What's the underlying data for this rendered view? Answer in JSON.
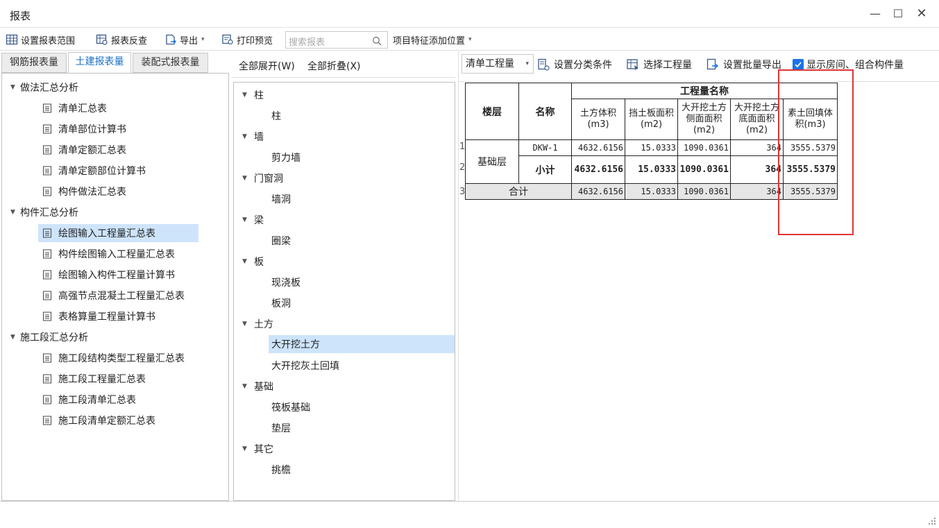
{
  "window": {
    "title": "报表"
  },
  "toolbar": {
    "set_range": "设置报表范围",
    "report_check": "报表反查",
    "export": "导出",
    "print_preview": "打印预览",
    "search_placeholder": "搜索报表",
    "item_feature_pos": "项目特征添加位置"
  },
  "left": {
    "tabs": [
      {
        "label": "钢筋报表量"
      },
      {
        "label": "土建报表量"
      },
      {
        "label": "装配式报表量"
      }
    ],
    "groups": [
      {
        "label": "做法汇总分析",
        "items": [
          "清单汇总表",
          "清单部位计算书",
          "清单定额汇总表",
          "清单定额部位计算书",
          "构件做法汇总表"
        ]
      },
      {
        "label": "构件汇总分析",
        "items": [
          "绘图输入工程量汇总表",
          "构件绘图输入工程量汇总表",
          "绘图输入构件工程量计算书",
          "高强节点混凝土工程量汇总表",
          "表格算量工程量计算书"
        ]
      },
      {
        "label": "施工段汇总分析",
        "items": [
          "施工段结构类型工程量汇总表",
          "施工段工程量汇总表",
          "施工段清单汇总表",
          "施工段清单定额汇总表"
        ]
      }
    ]
  },
  "middle": {
    "expand_all": "全部展开(W)",
    "collapse_all": "全部折叠(X)",
    "groups": [
      {
        "label": "柱",
        "items": [
          "柱"
        ]
      },
      {
        "label": "墙",
        "items": [
          "剪力墙"
        ]
      },
      {
        "label": "门窗洞",
        "items": [
          "墙洞"
        ]
      },
      {
        "label": "梁",
        "items": [
          "圈梁"
        ]
      },
      {
        "label": "板",
        "items": [
          "现浇板",
          "板洞"
        ]
      },
      {
        "label": "土方",
        "items": [
          "大开挖土方",
          "大开挖灰土回填"
        ]
      },
      {
        "label": "基础",
        "items": [
          "筏板基础",
          "垫层"
        ]
      },
      {
        "label": "其它",
        "items": [
          "挑檐"
        ]
      }
    ]
  },
  "right": {
    "combo_value": "清单工程量",
    "set_classify": "设置分类条件",
    "select_qty": "选择工程量",
    "set_batch_export": "设置批量导出",
    "show_room": "显示房间、组合构件量",
    "table": {
      "col_floor": "楼层",
      "col_name": "名称",
      "group_header": "工程量名称",
      "col1": "土方体积(m3)",
      "col2": "挡土板面积(m2)",
      "col3": "大开挖土方侧面面积(m2)",
      "col4": "大开挖土方底面面积(m2)",
      "col5": "素土回填体积(m3)",
      "row_numbers": [
        "1",
        "2",
        "3"
      ],
      "floor_value": "基础层",
      "row1": {
        "name": "DKW-1",
        "v1": "4632.6156",
        "v2": "15.0333",
        "v3": "1090.0361",
        "v4": "364",
        "v5": "3555.5379"
      },
      "row2": {
        "name": "小计",
        "v1": "4632.6156",
        "v2": "15.0333",
        "v3": "1090.0361",
        "v4": "364",
        "v5": "3555.5379"
      },
      "row3": {
        "name": "合计",
        "v1": "4632.6156",
        "v2": "15.0333",
        "v3": "1090.0361",
        "v4": "364",
        "v5": "3555.5379"
      }
    }
  },
  "colors": {
    "accent": "#1a6fc9",
    "selected_bg": "#cde4fb",
    "highlight": "#e03434"
  }
}
